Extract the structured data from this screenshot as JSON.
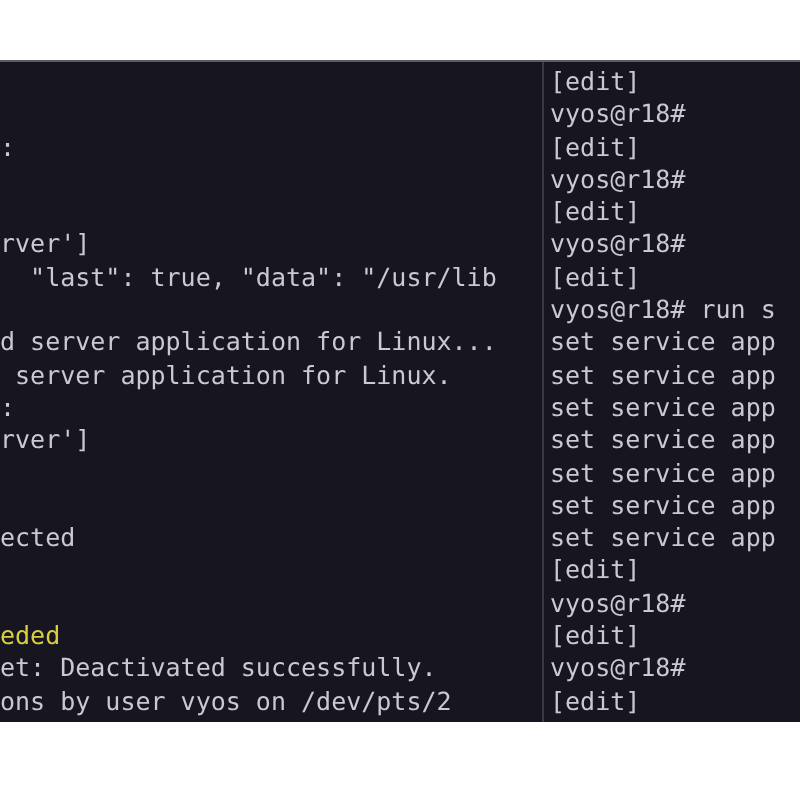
{
  "left_pane": {
    "lines": [
      {
        "kind": "blank"
      },
      {
        "kind": "blank"
      },
      {
        "text": ":",
        "kind": "text"
      },
      {
        "kind": "blank"
      },
      {
        "kind": "blank"
      },
      {
        "text": "rver']",
        "kind": "text"
      },
      {
        "text": "  \"last\": true, \"data\": \"/usr/lib",
        "kind": "text"
      },
      {
        "kind": "blank"
      },
      {
        "text": "d server application for Linux...",
        "kind": "text"
      },
      {
        "text": " server application for Linux.",
        "kind": "text"
      },
      {
        "text": ":",
        "kind": "text"
      },
      {
        "text": "rver']",
        "kind": "text"
      },
      {
        "kind": "blank"
      },
      {
        "kind": "blank"
      },
      {
        "text": "ected",
        "kind": "text"
      },
      {
        "kind": "blank"
      },
      {
        "kind": "blank"
      },
      {
        "text": "eded",
        "kind": "highlight"
      },
      {
        "text": "et: Deactivated successfully.",
        "kind": "text"
      },
      {
        "text": "ons by user vyos on /dev/pts/2",
        "kind": "text"
      }
    ]
  },
  "right_pane": {
    "lines": [
      {
        "text": "[edit]",
        "kind": "text"
      },
      {
        "text": "vyos@r18#",
        "kind": "text"
      },
      {
        "text": "[edit]",
        "kind": "text"
      },
      {
        "text": "vyos@r18#",
        "kind": "text"
      },
      {
        "text": "[edit]",
        "kind": "text"
      },
      {
        "text": "vyos@r18#",
        "kind": "text"
      },
      {
        "text": "[edit]",
        "kind": "text"
      },
      {
        "text": "vyos@r18# run s",
        "kind": "text"
      },
      {
        "text": "set service app",
        "kind": "text"
      },
      {
        "text": "set service app",
        "kind": "text"
      },
      {
        "text": "set service app",
        "kind": "text"
      },
      {
        "text": "set service app",
        "kind": "text"
      },
      {
        "text": "set service app",
        "kind": "text"
      },
      {
        "text": "set service app",
        "kind": "text"
      },
      {
        "text": "set service app",
        "kind": "text"
      },
      {
        "text": "[edit]",
        "kind": "text"
      },
      {
        "text": "vyos@r18#",
        "kind": "text"
      },
      {
        "text": "[edit]",
        "kind": "text"
      },
      {
        "text": "vyos@r18#",
        "kind": "text"
      },
      {
        "text": "[edit]",
        "kind": "text"
      }
    ]
  }
}
